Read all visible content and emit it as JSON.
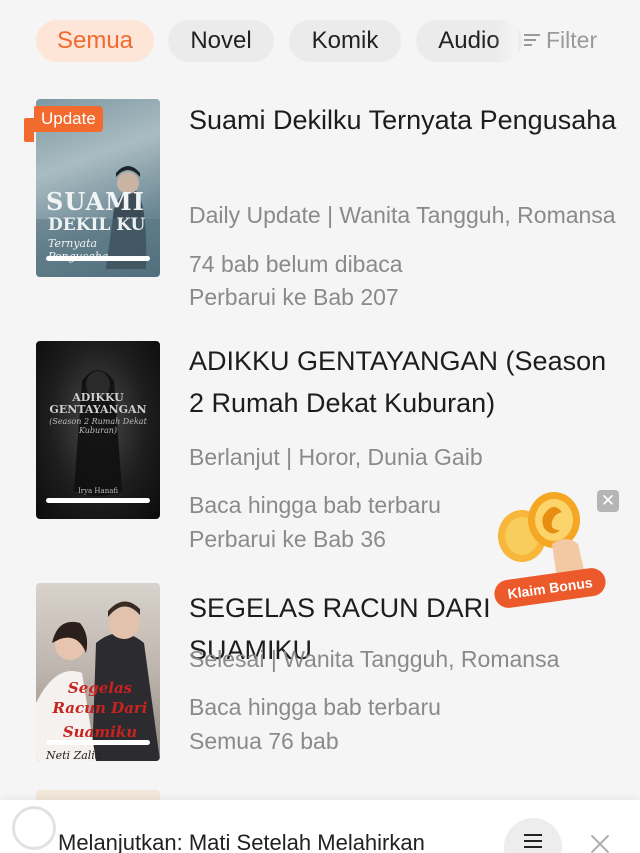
{
  "tabs": [
    {
      "label": "Semua",
      "active": true
    },
    {
      "label": "Novel",
      "active": false
    },
    {
      "label": "Komik",
      "active": false
    },
    {
      "label": "Audio",
      "active": false
    }
  ],
  "filter": {
    "label": "Filter",
    "icon": "filter-icon"
  },
  "colors": {
    "accent": "#f26a2e",
    "accent_bg": "#fde6d8",
    "muted_text": "#8a8a8a",
    "background": "#f5f5f5"
  },
  "books": [
    {
      "badge": "Update",
      "cover_text": [
        "SUAMI",
        "DEKIL KU",
        "Ternyata Pengusaha"
      ],
      "title": "Suami Dekilku Ternyata Pengusaha",
      "tags": "Daily Update | Wanita Tangguh, Romansa",
      "progress": "74 bab belum dibaca",
      "chapter": "Perbarui ke Bab 207"
    },
    {
      "cover_text": [
        "ADIKKU",
        "GENTAYANGAN",
        "(Season 2 Rumah Dekat Kuburan)",
        "Irya Hanafi"
      ],
      "title": "ADIKKU GENTAYANGAN (Season 2 Rumah Dekat Kuburan)",
      "tags": "Berlanjut | Horor, Dunia Gaib",
      "progress": "Baca hingga bab terbaru",
      "chapter": "Perbarui ke Bab 36"
    },
    {
      "cover_text": [
        "Segelas",
        "Racun Dari",
        "Suamiku",
        "Neti Zalia"
      ],
      "title": "SEGELAS RACUN DARI SUAMIKU",
      "tags": "Selesai | Wanita Tangguh, Romansa",
      "progress": "Baca hingga bab terbaru",
      "chapter": "Semua 76 bab"
    }
  ],
  "bonus": {
    "label": "Klaim Bonus",
    "icon": "coin-icon"
  },
  "bottom_bar": {
    "continue_text": "Melanjutkan:  Mati Setelah Melahirkan"
  }
}
